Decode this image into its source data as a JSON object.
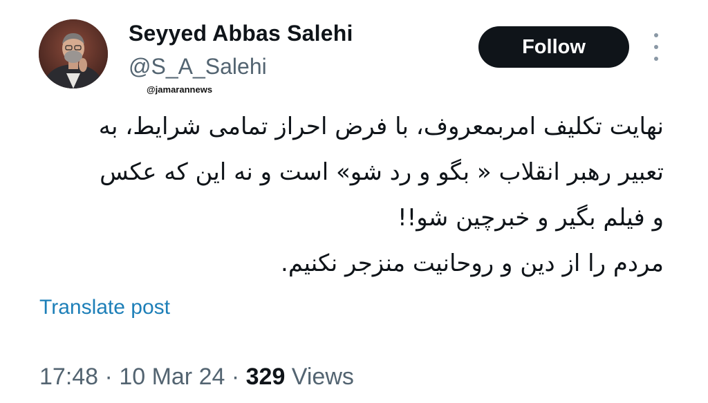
{
  "author": {
    "display_name": "Seyyed Abbas Salehi",
    "handle": "@S_A_Salehi",
    "avatar_icon": "profile-photo"
  },
  "watermark": "@jamarannews",
  "follow_label": "Follow",
  "more_icon": "vertical-ellipsis-icon",
  "tweet": {
    "lines": [
      "نهایت تکلیف امربمعروف، با فرض احراز تمامی شرایط، به",
      "تعبیر رهبر انقلاب « بگو و رد شو» است و نه این که عکس",
      "و فیلم بگیر و خبرچین شو!!",
      "مردم را از دین و روحانیت منزجر نکنیم."
    ]
  },
  "translate_label": "Translate post",
  "meta": {
    "time": "17:48",
    "separator": " · ",
    "date": "10 Mar 24",
    "views_count": "329",
    "views_label": " Views"
  },
  "colors": {
    "follow_bg": "#0f1419",
    "link": "#1d7fb8",
    "secondary_text": "#536471"
  }
}
